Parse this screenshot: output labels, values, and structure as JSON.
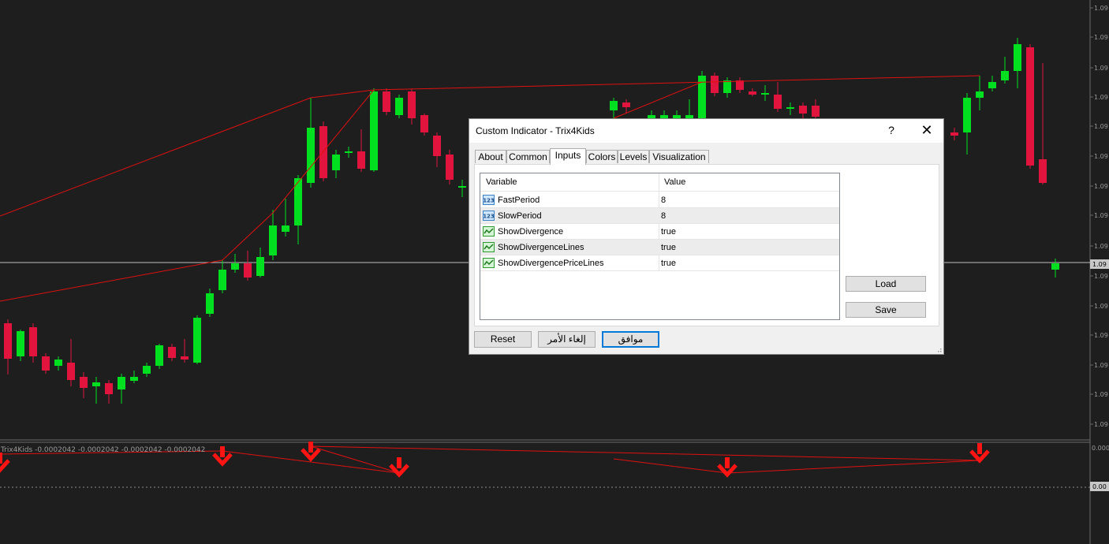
{
  "chart": {
    "price_ticks": [
      "1.09",
      "1.09",
      "1.09",
      "1.09",
      "1.09",
      "1.09",
      "1.09",
      "1.09",
      "1.09",
      "1.09",
      "1.09",
      "1.09",
      "1.09",
      "1.09",
      "1.09"
    ],
    "current_price_label": "1.09",
    "indicator_label": "Trix4Kids -0.0002042 -0.0002042 -0.0002042 -0.0002042",
    "indicator_ticks": [
      "0.000",
      "0.00"
    ],
    "colors": {
      "bull": "#00e020",
      "bear": "#e0143c",
      "line": "#e01010",
      "background": "#1e1e1e"
    }
  },
  "dialog": {
    "title": "Custom Indicator - Trix4Kids",
    "help_glyph": "?",
    "close_glyph": "✕",
    "tabs": [
      "About",
      "Common",
      "Inputs",
      "Colors",
      "Levels",
      "Visualization"
    ],
    "active_tab": "Inputs",
    "columns": {
      "variable": "Variable",
      "value": "Value"
    },
    "params": [
      {
        "name": "FastPeriod",
        "value": "8",
        "icon": "number-icon"
      },
      {
        "name": "SlowPeriod",
        "value": "8",
        "icon": "number-icon"
      },
      {
        "name": "ShowDivergence",
        "value": "true",
        "icon": "boolean-icon"
      },
      {
        "name": "ShowDivergenceLines",
        "value": "true",
        "icon": "boolean-icon"
      },
      {
        "name": "ShowDivergencePriceLines",
        "value": "true",
        "icon": "boolean-icon"
      }
    ],
    "load_label": "Load",
    "save_label": "Save",
    "reset_label": "Reset",
    "cancel_label": "إلغاء الأمر",
    "ok_label": "موافق"
  }
}
